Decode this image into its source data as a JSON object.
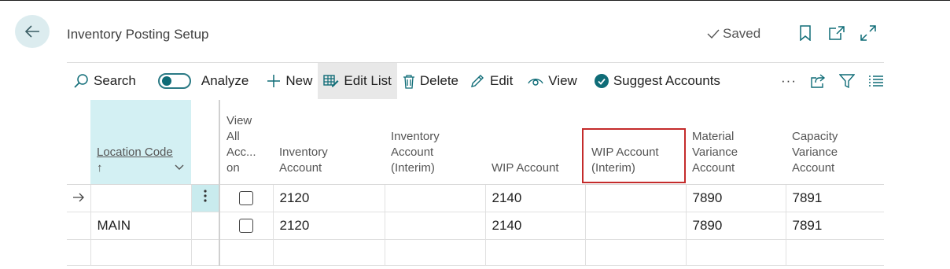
{
  "page": {
    "title": "Inventory Posting Setup",
    "saved_status": "Saved"
  },
  "toolbar": {
    "search": "Search",
    "analyze": "Analyze",
    "new": "New",
    "edit_list": "Edit List",
    "delete": "Delete",
    "edit": "Edit",
    "view": "View",
    "suggest_accounts": "Suggest Accounts",
    "more": "···"
  },
  "columns": {
    "location_code": "Location Code",
    "sort_arrow": "↑",
    "view_all_accounts": [
      "View",
      "All",
      "Acc...",
      "on"
    ],
    "inventory_account": [
      "Inventory",
      "Account"
    ],
    "inventory_account_interim": [
      "Inventory",
      "Account",
      "(Interim)"
    ],
    "wip_account": "WIP Account",
    "wip_account_interim": [
      "WIP Account",
      "(Interim)"
    ],
    "material_variance_account": [
      "Material",
      "Variance",
      "Account"
    ],
    "capacity_variance_account": [
      "Capacity",
      "Variance",
      "Account"
    ]
  },
  "rows": [
    {
      "location_code": "",
      "inventory_account": "2120",
      "inventory_account_interim": "",
      "wip_account": "2140",
      "wip_account_interim": "",
      "material_variance_account": "7890",
      "capacity_variance_account": "7891"
    },
    {
      "location_code": "MAIN",
      "inventory_account": "2120",
      "inventory_account_interim": "",
      "wip_account": "2140",
      "wip_account_interim": "",
      "material_variance_account": "7890",
      "capacity_variance_account": "7891"
    }
  ],
  "colors": {
    "accent": "#0f6c77",
    "selected_column": "#d3f0f3",
    "highlight_border": "#c42b2b"
  },
  "icons": [
    "back-arrow-icon",
    "checkmark-icon",
    "bookmark-icon",
    "open-in-new-icon",
    "expand-icon",
    "search-icon",
    "plus-icon",
    "edit-list-icon",
    "trash-icon",
    "pencil-icon",
    "eye-icon",
    "check-circle-icon",
    "share-icon",
    "filter-icon",
    "list-icon",
    "row-arrow-icon",
    "row-menu-icon"
  ]
}
